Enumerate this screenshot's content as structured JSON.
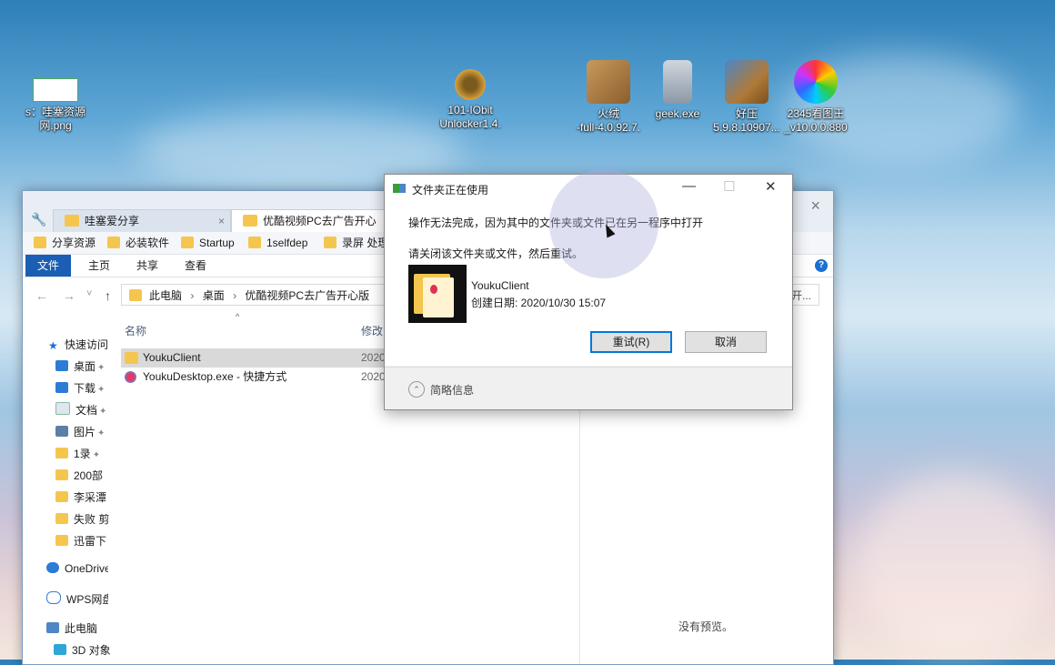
{
  "desktop": {
    "icons": [
      {
        "label1": "s：哇塞资源",
        "label2": "网.png"
      },
      {
        "label1": "101-IObit",
        "label2": "Unlocker1.4."
      },
      {
        "label1": "火绒",
        "label2": "-full-4.0.92.7."
      },
      {
        "label1": "geek.exe",
        "label2": ""
      },
      {
        "label1": "好压",
        "label2": "5.9.8.10907..."
      },
      {
        "label1": "2345看图王",
        "label2": "_v10.0.0.880"
      }
    ]
  },
  "explorer": {
    "tabs": [
      {
        "label": "哇塞爱分享",
        "close": "×"
      },
      {
        "label": "优酷视频PC去广告开心版",
        "close": ""
      }
    ],
    "close_glyph": "×",
    "bookmarks": [
      "分享资源",
      "必装软件",
      "Startup",
      "1selfdep",
      "录屏 处理"
    ],
    "ribbon": {
      "file": "文件",
      "home": "主页",
      "share": "共享",
      "view": "查看"
    },
    "help": "?",
    "nav": {
      "back": "←",
      "forward": "→",
      "recent": "˅",
      "up": "↑"
    },
    "breadcrumb": {
      "seg1": "此电脑",
      "sep": "›",
      "seg2": "桌面",
      "seg3": "优酷视频PC去广告开心版"
    },
    "search_hint": "开...",
    "sidebar": {
      "quick_access": "快速访问",
      "items": [
        "桌面",
        "下载",
        "文档",
        "图片",
        "1录",
        "200部",
        "李采潭",
        "失败 剪",
        "迅雷下"
      ],
      "onedrive": "OneDrive",
      "wps": "WPS网盘",
      "thispc": "此电脑",
      "objects3d": "3D 对象"
    },
    "columns": {
      "name": "名称",
      "modified": "修改日"
    },
    "files": [
      {
        "name": "YoukuClient",
        "date": "2020"
      },
      {
        "name": "YoukuDesktop.exe - 快捷方式",
        "date": "2020"
      }
    ],
    "no_preview": "没有预览。"
  },
  "dialog": {
    "title": "文件夹正在使用",
    "minimize": "—",
    "maximize": "☐",
    "close": "✕",
    "message1": "操作无法完成，因为其中的文件夹或文件已在另一程序中打开",
    "message2": "请关闭该文件夹或文件，然后重试。",
    "item_name": "YoukuClient",
    "item_date": "创建日期: 2020/10/30 15:07",
    "retry": "重试(R)",
    "cancel": "取消",
    "brief_info": "简略信息",
    "chev": "⌃"
  },
  "colors": {
    "accent": "#1a5fb4",
    "folder": "#f5c64e"
  }
}
